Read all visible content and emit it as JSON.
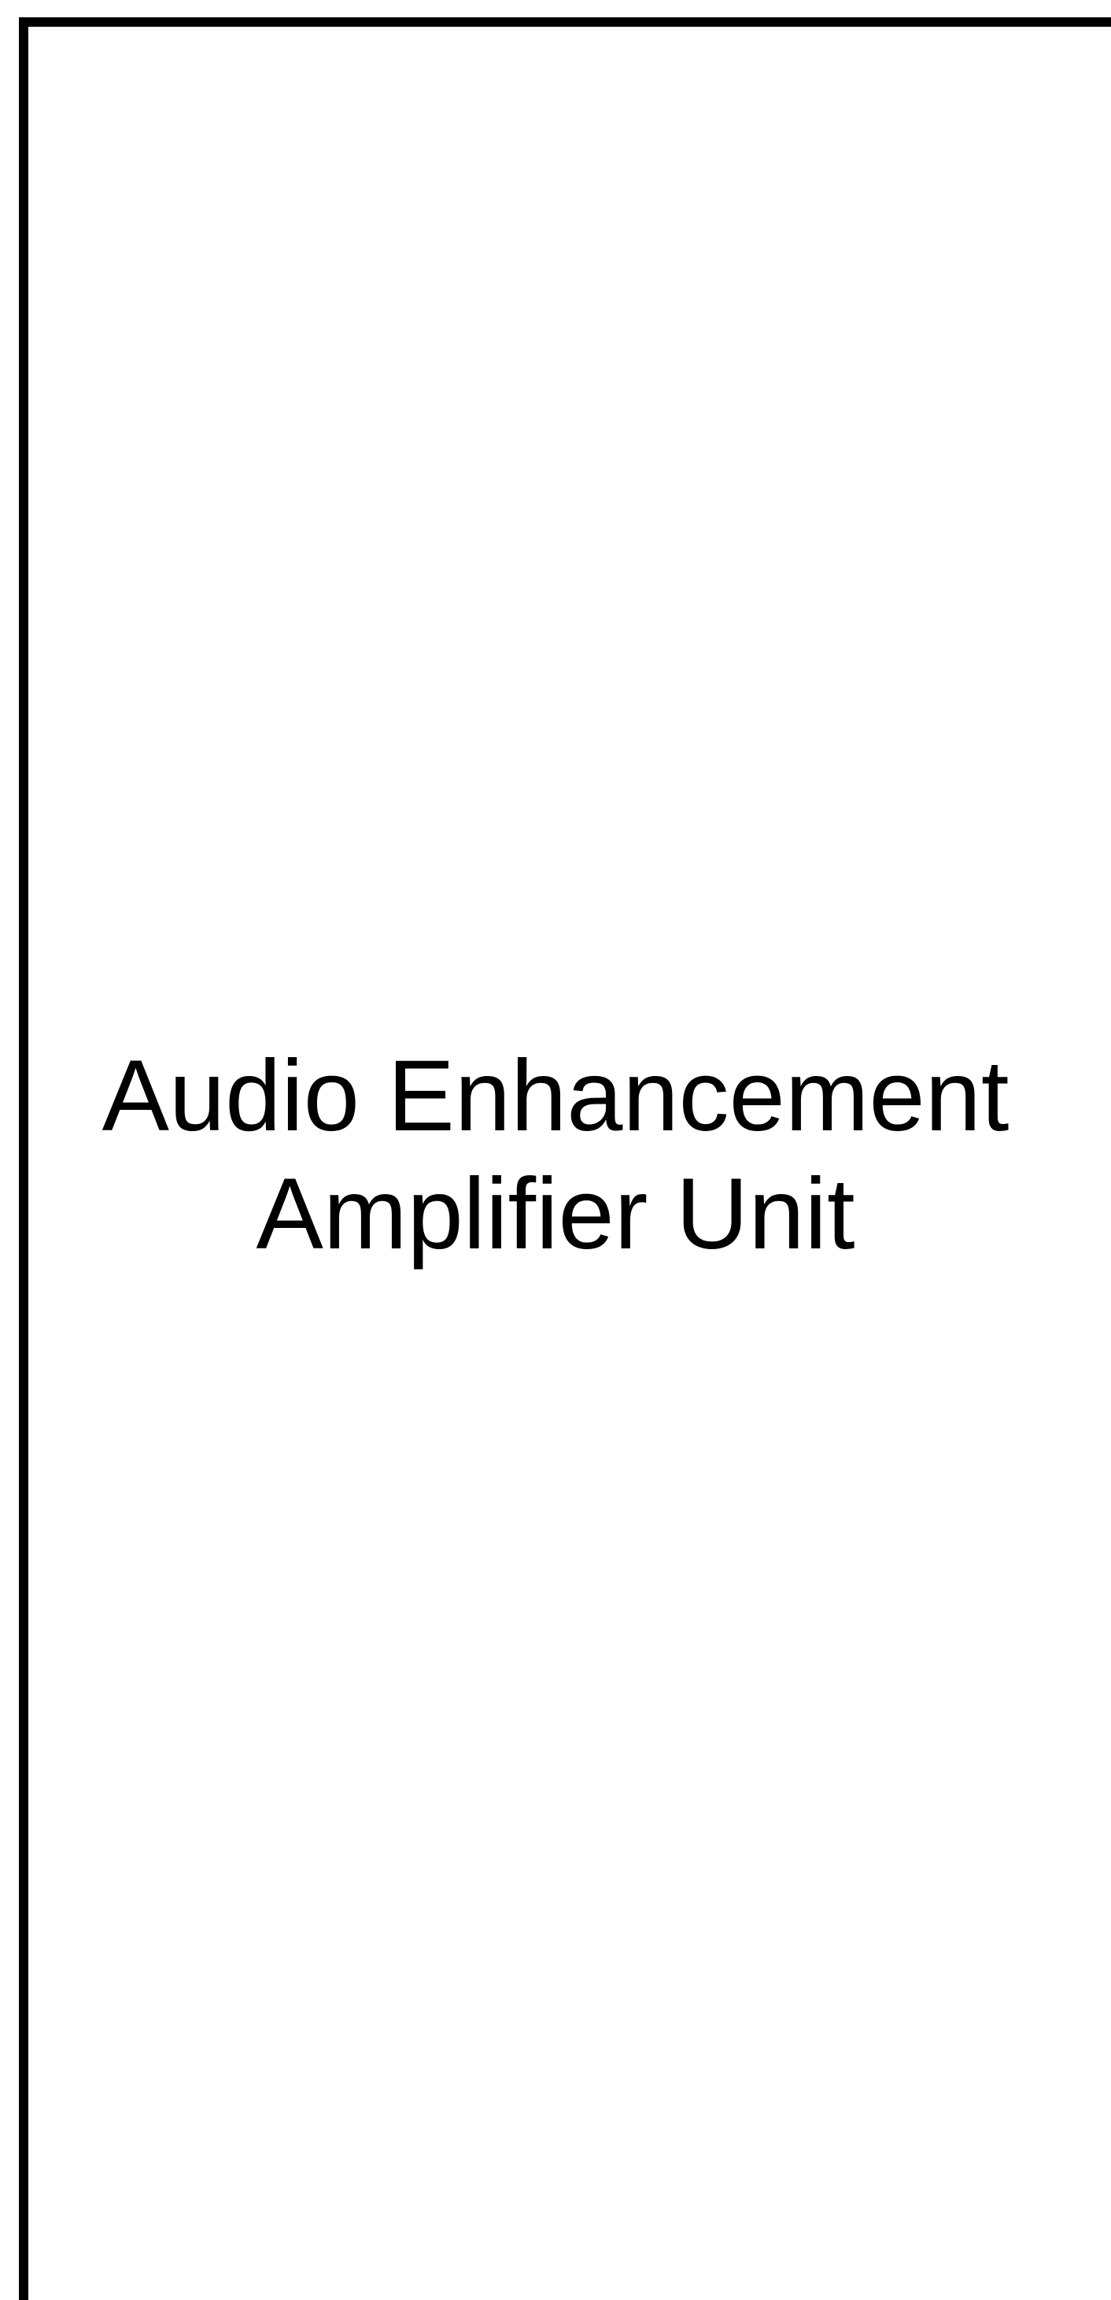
{
  "block": {
    "label_line1": "Audio Enhancement",
    "label_line2": "Amplifier Unit",
    "border_color": "#000000",
    "background_color": "#ffffff"
  }
}
